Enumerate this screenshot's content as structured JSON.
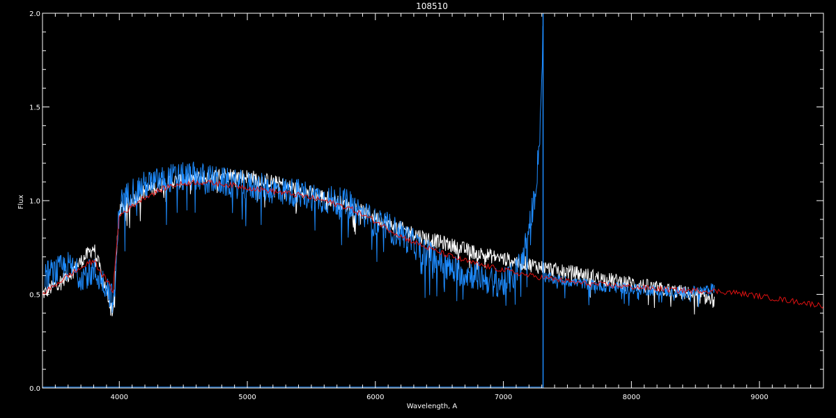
{
  "chart_data": {
    "type": "line",
    "title": "108510",
    "xlabel": "Wavelength, A",
    "ylabel": "Flux",
    "xlim": [
      3400,
      9500
    ],
    "ylim": [
      0.0,
      2.0
    ],
    "grid": false,
    "x_ticks": [
      {
        "value": 4000,
        "label": "4000"
      },
      {
        "value": 5000,
        "label": "5000"
      },
      {
        "value": 6000,
        "label": "6000"
      },
      {
        "value": 7000,
        "label": "7000"
      },
      {
        "value": 8000,
        "label": "8000"
      },
      {
        "value": 9000,
        "label": "9000"
      }
    ],
    "y_ticks": [
      {
        "value": 0.0,
        "label": "0.0"
      },
      {
        "value": 0.5,
        "label": "0.5"
      },
      {
        "value": 1.0,
        "label": "1.0"
      },
      {
        "value": 1.5,
        "label": "1.5"
      },
      {
        "value": 2.0,
        "label": "2.0"
      }
    ],
    "colors": {
      "background": "#000000",
      "axes": "#ffffff",
      "white_series": "#ffffff",
      "blue_series": "#1e8cff",
      "red_series": "#dd1111"
    },
    "series": [
      {
        "name": "",
        "color": "#ffffff",
        "noise": 0.04,
        "x": [
          3400,
          3600,
          3800,
          3950,
          4000,
          4200,
          4400,
          4600,
          4800,
          5000,
          5200,
          5400,
          5600,
          5800,
          6000,
          6200,
          6400,
          6600,
          6800,
          7000,
          7200,
          7400,
          7600,
          7800,
          8000,
          8200,
          8400,
          8600,
          8650
        ],
        "y": [
          0.5,
          0.6,
          0.75,
          0.4,
          0.95,
          1.05,
          1.1,
          1.12,
          1.14,
          1.13,
          1.1,
          1.06,
          1.02,
          0.97,
          0.91,
          0.85,
          0.8,
          0.76,
          0.72,
          0.69,
          0.66,
          0.63,
          0.61,
          0.58,
          0.56,
          0.53,
          0.51,
          0.48,
          0.46
        ]
      },
      {
        "name": "",
        "color": "#1e8cff",
        "noise": 0.08,
        "x": [
          3420,
          3500,
          3600,
          3700,
          3800,
          3900,
          3960,
          4000,
          4100,
          4200,
          4400,
          4600,
          4800,
          5000,
          5200,
          5400,
          5600,
          5800,
          5900,
          6000,
          6100,
          6200,
          6400,
          6600,
          6800,
          6900,
          7000,
          7050,
          7100,
          7150,
          7200,
          7250,
          7280,
          7300,
          7310
        ],
        "y": [
          0.6,
          0.62,
          0.65,
          0.6,
          0.62,
          0.55,
          0.45,
          0.98,
          1.05,
          1.08,
          1.12,
          1.13,
          1.1,
          1.08,
          1.06,
          1.04,
          1.01,
          0.98,
          0.93,
          0.88,
          0.86,
          0.82,
          0.72,
          0.63,
          0.6,
          0.57,
          0.56,
          0.58,
          0.62,
          0.7,
          0.84,
          1.05,
          1.3,
          1.65,
          2.0
        ]
      },
      {
        "name": "",
        "color": "#1e8cff",
        "noise": 0.03,
        "x": [
          7320,
          7400,
          7600,
          7800,
          8000,
          8200,
          8400,
          8600,
          8650
        ],
        "y": [
          0.59,
          0.58,
          0.56,
          0.54,
          0.53,
          0.52,
          0.51,
          0.52,
          0.54
        ]
      },
      {
        "name": "",
        "color": "#dd1111",
        "noise": 0.015,
        "x": [
          3400,
          3600,
          3800,
          3950,
          4000,
          4200,
          4400,
          4600,
          4800,
          5000,
          5200,
          5400,
          5600,
          5800,
          6000,
          6200,
          6400,
          6600,
          6800,
          7000,
          7200,
          7400,
          7600,
          7800,
          8000,
          8200,
          8400,
          8600,
          8800,
          9000,
          9200,
          9400,
          9500
        ],
        "y": [
          0.5,
          0.6,
          0.68,
          0.52,
          0.92,
          1.02,
          1.08,
          1.1,
          1.09,
          1.07,
          1.05,
          1.03,
          1.0,
          0.96,
          0.89,
          0.81,
          0.75,
          0.7,
          0.66,
          0.63,
          0.6,
          0.58,
          0.56,
          0.55,
          0.54,
          0.53,
          0.52,
          0.52,
          0.51,
          0.49,
          0.47,
          0.45,
          0.44
        ]
      }
    ],
    "vertical_lines": [
      {
        "x": 7310,
        "y_from": 0.0,
        "y_to": 2.0,
        "color": "#1e8cff"
      }
    ],
    "baseline": {
      "color": "#1e8cff",
      "x_from": 3400,
      "x_to": 7300,
      "y": 0.005
    }
  }
}
